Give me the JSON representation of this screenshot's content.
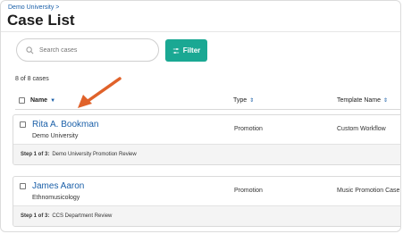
{
  "header": {
    "breadcrumb": "Demo University >",
    "title": "Case List"
  },
  "search": {
    "placeholder": "Search cases",
    "icon": "search-icon"
  },
  "filter_button": {
    "label": "Filter",
    "icon": "sliders-icon",
    "color": "#1aa893"
  },
  "count_text": "8 of 8 cases",
  "columns": {
    "name": "Name",
    "type": "Type",
    "template": "Template Name"
  },
  "cases": [
    {
      "name": "Rita A. Bookman",
      "org": "Demo University",
      "type": "Promotion",
      "template": "Custom Workflow",
      "step_label": "Step 1 of 3:",
      "step_text": "Demo University Promotion Review"
    },
    {
      "name": "James Aaron",
      "org": "Ethnomusicology",
      "type": "Promotion",
      "template": "Music Promotion Case",
      "step_label": "Step 1 of 3:",
      "step_text": "CCS Department Review"
    }
  ],
  "colors": {
    "link": "#1a5fa8",
    "annotation_arrow": "#e0622a"
  }
}
